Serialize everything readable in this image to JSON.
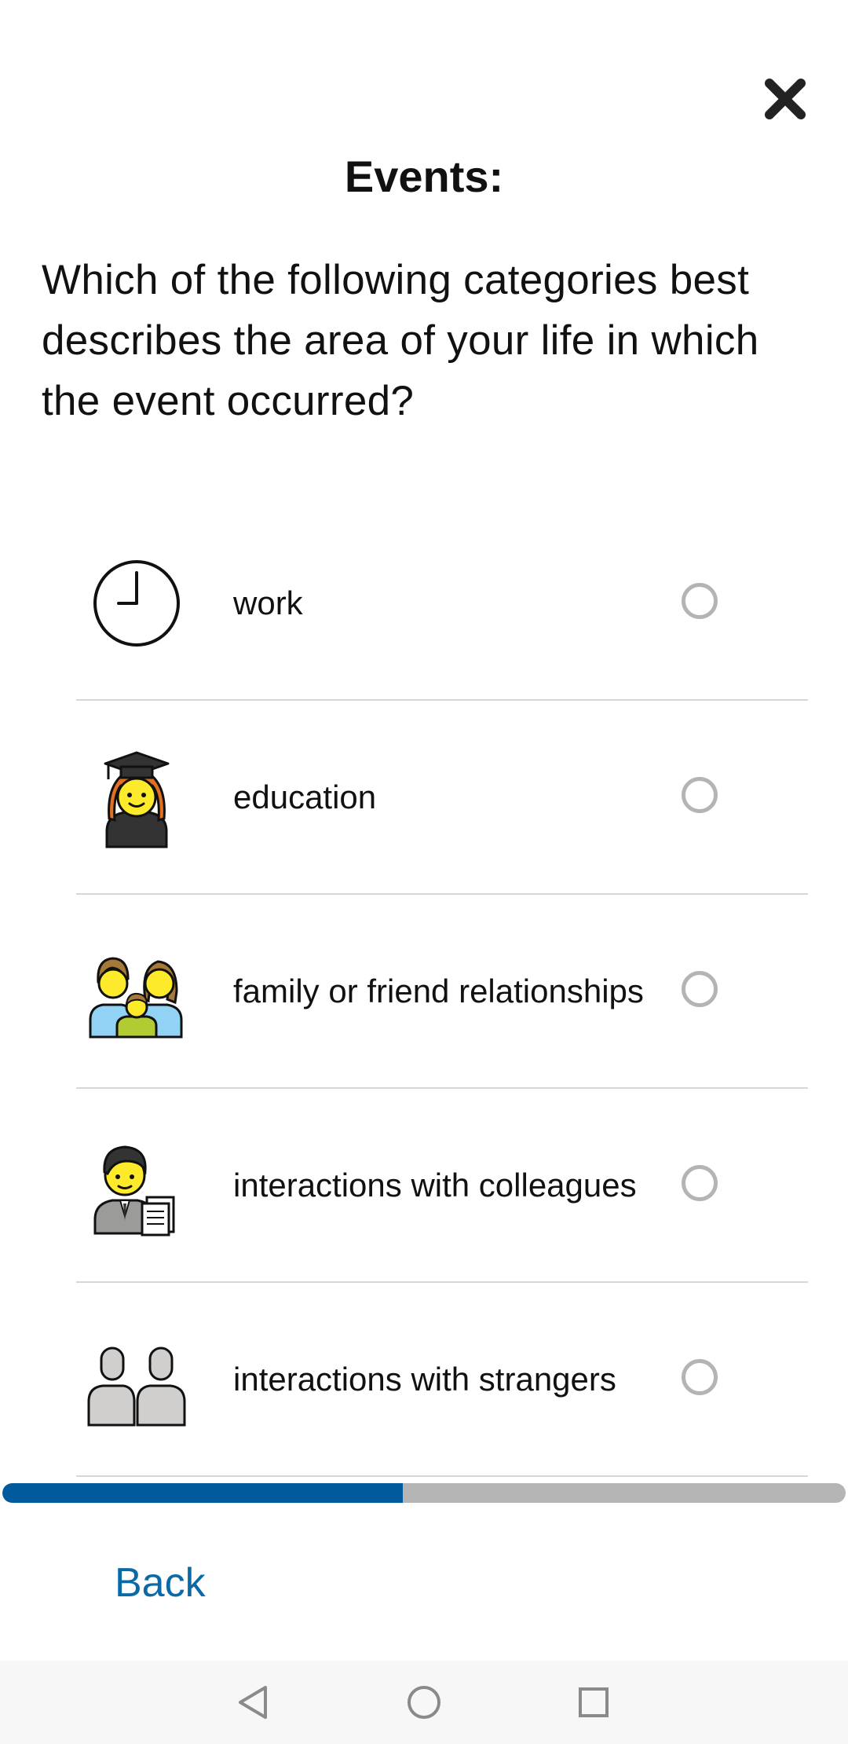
{
  "header": {
    "title": "Events:",
    "close_icon": "close-icon"
  },
  "question": "Which of the following categories best describes the area of your life in which the event occurred?",
  "options": [
    {
      "label": "work",
      "icon": "clock-icon",
      "selected": false
    },
    {
      "label": "education",
      "icon": "graduate-icon",
      "selected": false
    },
    {
      "label": "family or friend relationships",
      "icon": "family-icon",
      "selected": false
    },
    {
      "label": "interactions with colleagues",
      "icon": "office-worker-icon",
      "selected": false
    },
    {
      "label": "interactions with strangers",
      "icon": "people-icon",
      "selected": false
    }
  ],
  "progress": {
    "fraction": 0.475,
    "fill_color": "#005a9c",
    "track_color": "#b5b5b5"
  },
  "footer": {
    "back_label": "Back",
    "back_color": "#0a6aa8"
  },
  "nav_bar": {
    "back_icon": "nav-back-icon",
    "home_icon": "nav-home-icon",
    "recents_icon": "nav-recents-icon"
  }
}
